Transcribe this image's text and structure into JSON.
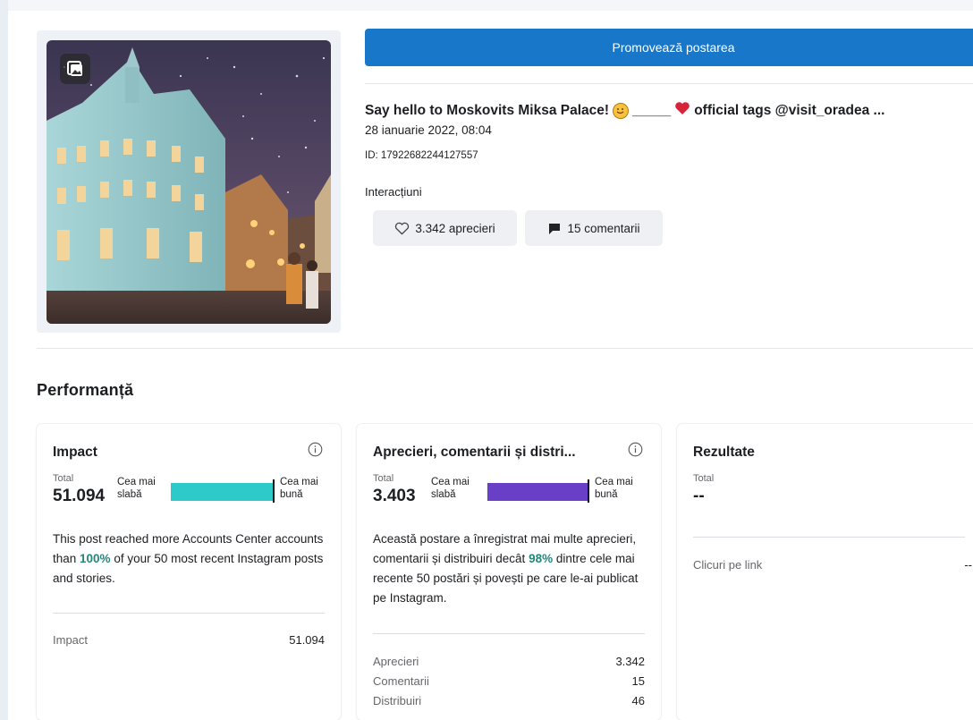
{
  "promote_button": "Promovează postarea",
  "post": {
    "title_part1": "Say hello to Moskovits Miksa Palace!",
    "title_part2": "_____",
    "title_part3": "official tags @visit_oradea ...",
    "date": "28 ianuarie 2022, 08:04",
    "id": "ID: 17922682244127557",
    "interactions_label": "Interacțiuni",
    "likes_chip": "3.342 aprecieri",
    "comments_chip": "15 comentarii"
  },
  "performance": {
    "title": "Performanță",
    "impact_card": {
      "title": "Impact",
      "total_label": "Total",
      "total_value": "51.094",
      "scale_low_1": "Cea mai",
      "scale_low_2": "slabă",
      "scale_high_1": "Cea mai",
      "scale_high_2": "bună",
      "bar_color": "#2ec9c9",
      "bar_fraction": 1.0,
      "desc_1": "This post reached more Accounts Center accounts than ",
      "desc_highlight": "100%",
      "desc_2": " of your 50 most recent Instagram posts and stories.",
      "rows": [
        {
          "label": "Impact",
          "value": "51.094"
        }
      ]
    },
    "engagement_card": {
      "title": "Aprecieri, comentarii și distri...",
      "total_label": "Total",
      "total_value": "3.403",
      "scale_low_1": "Cea mai",
      "scale_low_2": "slabă",
      "scale_high_1": "Cea mai",
      "scale_high_2": "bună",
      "bar_color": "#6a3fc8",
      "bar_fraction": 0.98,
      "desc_1": "Această postare a înregistrat mai multe aprecieri, comentarii și distribuiri decât ",
      "desc_highlight": "98%",
      "desc_2": " dintre cele mai recente 50 postări și povești pe care le-ai publicat pe Instagram.",
      "rows": [
        {
          "label": "Aprecieri",
          "value": "3.342"
        },
        {
          "label": "Comentarii",
          "value": "15"
        },
        {
          "label": "Distribuiri",
          "value": "46"
        }
      ]
    },
    "results_card": {
      "title": "Rezultate",
      "total_label": "Total",
      "total_value": "--",
      "rows": [
        {
          "label": "Clicuri pe link",
          "value": "--"
        }
      ]
    }
  },
  "colors": {
    "primary_blue": "#1877c9",
    "teal_highlight": "#25877a"
  },
  "icons": [
    "image-carousel-icon",
    "heart-outline-icon",
    "comment-bubble-icon",
    "info-icon",
    "smile-emoji-icon",
    "red-heart-emoji-icon"
  ]
}
